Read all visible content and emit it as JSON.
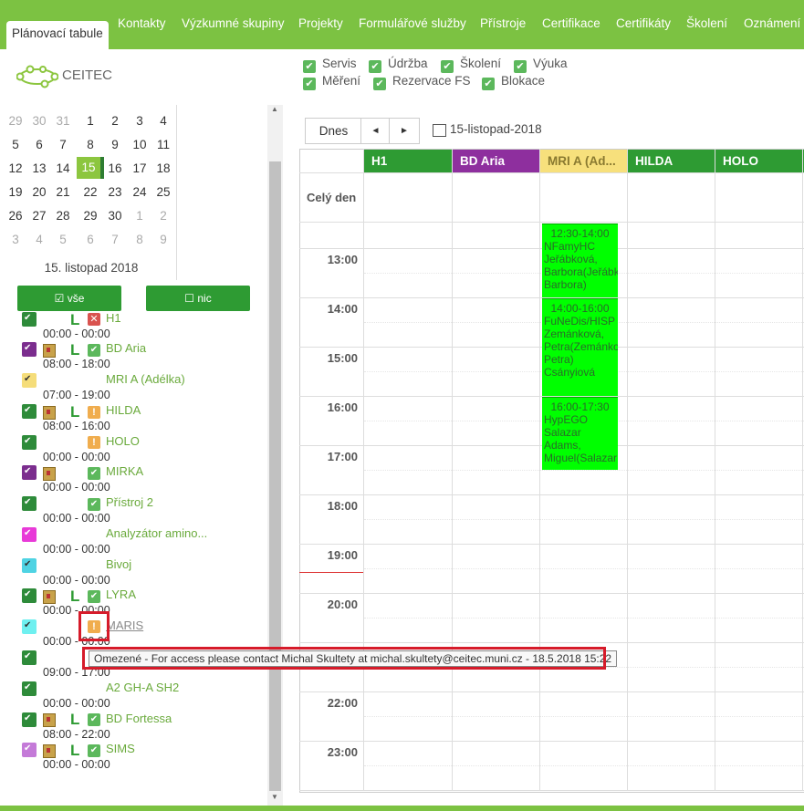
{
  "nav": {
    "tabs": [
      "Plánovací tabule",
      "Kontakty",
      "Výzkumné skupiny",
      "Projekty",
      "Formulářové služby",
      "Přístroje",
      "Certifikace",
      "Certifikáty",
      "Školení",
      "Oznámení"
    ]
  },
  "logo": {
    "text": "CEITEC"
  },
  "filters": [
    "Servis",
    "Údržba",
    "Školení",
    "Výuka",
    "Měření",
    "Rezervace FS",
    "Blokace"
  ],
  "calendar": {
    "rows": [
      [
        "29",
        "30",
        "31",
        "1",
        "2",
        "3",
        "4"
      ],
      [
        "5",
        "6",
        "7",
        "8",
        "9",
        "10",
        "11"
      ],
      [
        "12",
        "13",
        "14",
        "15",
        "16",
        "17",
        "18"
      ],
      [
        "19",
        "20",
        "21",
        "22",
        "23",
        "24",
        "25"
      ],
      [
        "26",
        "27",
        "28",
        "29",
        "30",
        "1",
        "2"
      ],
      [
        "3",
        "4",
        "5",
        "6",
        "7",
        "8",
        "9"
      ]
    ],
    "selected_date": "15. listopad 2018"
  },
  "buttons": {
    "all": "vše",
    "none": "nic"
  },
  "devices": [
    {
      "name": "H1",
      "time": "00:00 - 00:00",
      "color": "#2e8b3a"
    },
    {
      "name": "BD Aria",
      "time": "08:00 - 18:00",
      "color": "#7b2d8e"
    },
    {
      "name": "MRI A (Adélka)",
      "time": "07:00 - 19:00",
      "color": "#f5dd7a"
    },
    {
      "name": "HILDA",
      "time": "08:00 - 16:00",
      "color": "#2e8b3a"
    },
    {
      "name": "HOLO",
      "time": "00:00 - 00:00",
      "color": "#2e8b3a"
    },
    {
      "name": "MIRKA",
      "time": "00:00 - 00:00",
      "color": "#7b2d8e"
    },
    {
      "name": "Přístroj 2",
      "time": "00:00 - 00:00",
      "color": "#2e8b3a"
    },
    {
      "name": "Analyzátor amino...",
      "time": "00:00 - 00:00",
      "color": "#e83ad8"
    },
    {
      "name": "Bivoj",
      "time": "00:00 - 00:00",
      "color": "#4fd3e3"
    },
    {
      "name": "LYRA",
      "time": "00:00 - 00:00",
      "color": "#2e8b3a"
    },
    {
      "name": "MARIS",
      "time": "00:00 - 00:00",
      "color": "#6ff0f0"
    },
    {
      "name": "",
      "time": "09:00 - 17:00",
      "color": "#2e8b3a"
    },
    {
      "name": "A2 GH-A SH2",
      "time": "00:00 - 00:00",
      "color": "#2e8b3a"
    },
    {
      "name": "BD Fortessa",
      "time": "08:00 - 22:00",
      "color": "#2e8b3a"
    },
    {
      "name": "SIMS",
      "time": "00:00 - 00:00",
      "color": "#c47ad8"
    }
  ],
  "tooltip": "Omezené - For access please contact Michal Skultety at michal.skultety@ceitec.muni.cz - 18.5.2018 15:22",
  "toolbar": {
    "today": "Dnes",
    "prev": "◄",
    "next": "►",
    "date": "15-listopad-2018"
  },
  "columns": [
    {
      "name": "H1",
      "color": "#2e9b33"
    },
    {
      "name": "BD Aria",
      "color": "#8e2f9e"
    },
    {
      "name": "MRI A (Ad...",
      "color": "#f7e07c"
    },
    {
      "name": "HILDA",
      "color": "#2e9b33"
    },
    {
      "name": "HOLO",
      "color": "#2e9b33"
    }
  ],
  "all_day_label": "Celý den",
  "hours": [
    "13:00",
    "14:00",
    "15:00",
    "16:00",
    "17:00",
    "18:00",
    "19:00",
    "20:00",
    "22:00",
    "23:00"
  ],
  "events": [
    {
      "time": "12:30-14:00",
      "text": "NFamyHC Jeřábková, Barbora(Jeřábková, Barbora)"
    },
    {
      "time": "14:00-16:00",
      "text": "FuNeDis/HISP Zemánková, Petra(Zemánková, Petra) Csányiová"
    },
    {
      "time": "16:00-17:30",
      "text": "HypEGO Salazar Adams, Miguel(Salazar"
    }
  ]
}
